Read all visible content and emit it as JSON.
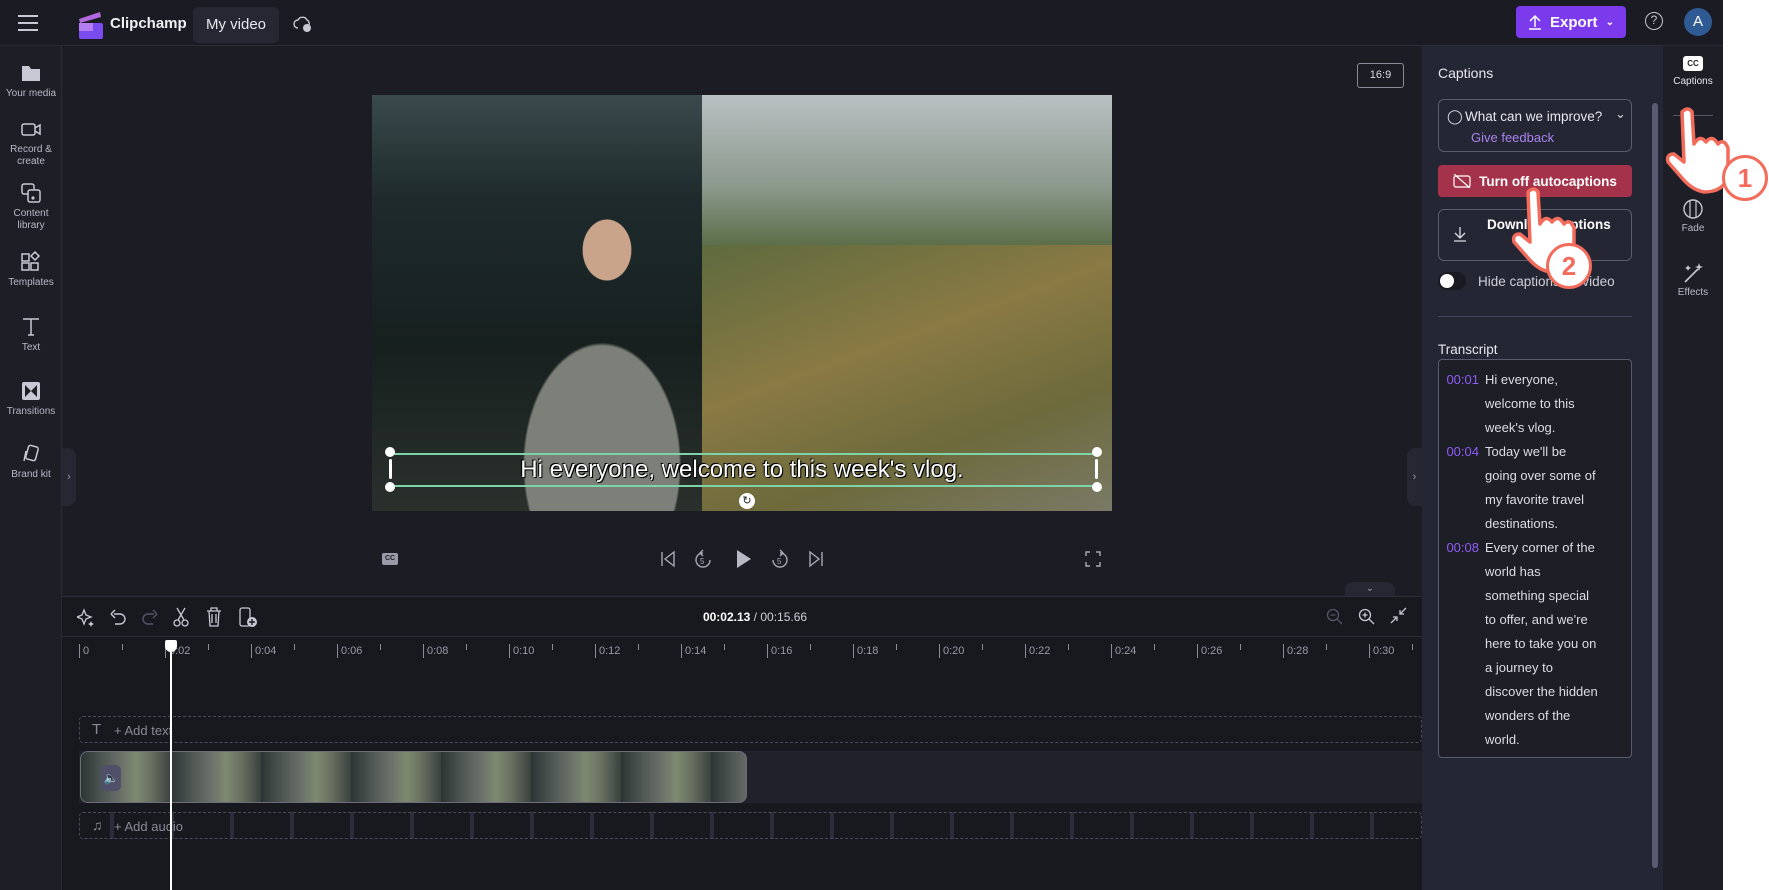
{
  "app": {
    "name": "Clipchamp",
    "project_title": "My video",
    "export_label": "Export",
    "avatar_initial": "A",
    "accent": "#7c3aed"
  },
  "sidebar": {
    "items": [
      {
        "label": "Your media",
        "icon": "folder-icon"
      },
      {
        "label": "Record &",
        "label2": "create",
        "icon": "camera-icon"
      },
      {
        "label": "Content",
        "label2": "library",
        "icon": "content-library-icon"
      },
      {
        "label": "Templates",
        "icon": "templates-icon"
      },
      {
        "label": "Text",
        "icon": "text-icon"
      },
      {
        "label": "Transitions",
        "icon": "transitions-icon"
      },
      {
        "label": "Brand kit",
        "icon": "brand-kit-icon"
      }
    ]
  },
  "preview": {
    "aspect_ratio": "16:9",
    "caption_text": "Hi everyone, welcome to this week's vlog."
  },
  "timeline": {
    "current_time": "00:02.13",
    "separator": "/",
    "total_time": "00:15.66",
    "ruler": [
      "0",
      "0:02",
      "0:04",
      "0:06",
      "0:08",
      "0:10",
      "0:12",
      "0:14",
      "0:16",
      "0:18",
      "0:20",
      "0:22",
      "0:24",
      "0:26",
      "0:28",
      "0:30"
    ],
    "add_text": "+ Add text",
    "add_audio": "+ Add audio",
    "playhead_seconds": 2.13
  },
  "captions_panel": {
    "title": "Captions",
    "feedback_question": "What can we improve?",
    "feedback_link": "Give feedback",
    "turn_off_label": "Turn off autocaptions",
    "download_label": "Download captions",
    "hide_label": "Hide captions on video",
    "hide_on": false,
    "turn_off_color": "#a4324a",
    "transcript_title": "Transcript",
    "transcript": [
      {
        "time": "00:01",
        "lines": [
          "Hi everyone,",
          "welcome to this",
          "week's vlog."
        ]
      },
      {
        "time": "00:04",
        "lines": [
          "Today we'll be",
          "going over some of",
          "my favorite travel",
          "destinations."
        ]
      },
      {
        "time": "00:08",
        "lines": [
          "Every corner of the",
          "world has",
          "something special",
          "to offer, and we're",
          "here to take you on",
          "a journey to",
          "discover the hidden",
          "wonders of the",
          "world."
        ]
      }
    ]
  },
  "rail": {
    "items": [
      {
        "label": "Captions",
        "icon": "cc-icon"
      },
      {
        "label": "Fade",
        "icon": "fade-icon"
      },
      {
        "label": "Effects",
        "icon": "effects-icon"
      }
    ]
  },
  "annotations": {
    "step1": "1",
    "step2": "2",
    "color": "#f26b5b"
  }
}
